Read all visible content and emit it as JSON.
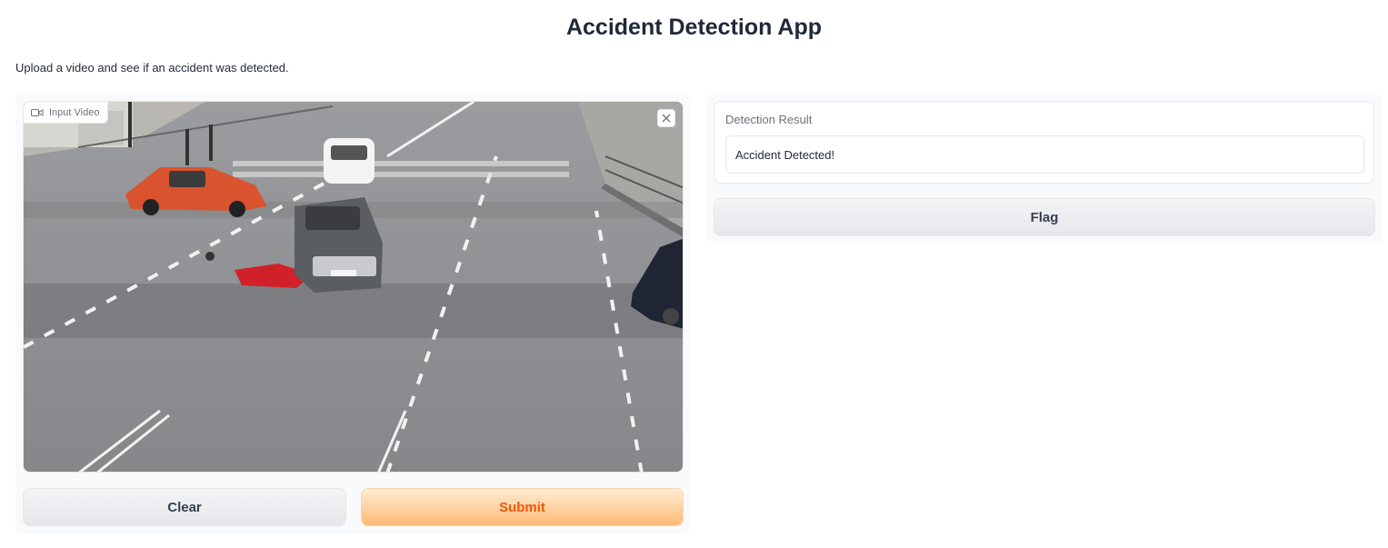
{
  "app": {
    "title": "Accident Detection App",
    "description": "Upload a video and see if an accident was detected."
  },
  "input": {
    "label": "Input Video",
    "icon": "video-camera-icon",
    "close_icon": "close-icon",
    "frame": "road intersection CCTV frame with collision"
  },
  "buttons": {
    "clear": "Clear",
    "submit": "Submit",
    "flag": "Flag"
  },
  "output": {
    "label": "Detection Result",
    "value": "Accident Detected!"
  },
  "colors": {
    "accent": "#ea580c",
    "submit_bg": "#fdba74"
  }
}
